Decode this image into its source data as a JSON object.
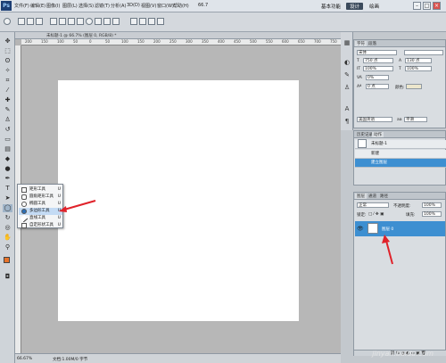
{
  "menubar": {
    "logo": "Ps",
    "items": [
      "文件(F)",
      "编辑(E)",
      "图像(I)",
      "图层(L)",
      "选择(S)",
      "滤镜(T)",
      "分析(A)",
      "3D(D)",
      "视图(V)",
      "窗口(W)",
      "帮助(H)"
    ],
    "zoom": "66.7",
    "workspaces": [
      "基本功能",
      "设计",
      "绘画"
    ],
    "win_min": "–",
    "win_max": "□",
    "win_close": "×"
  },
  "document": {
    "tab_title": "未标题-1 @ 66.7% (图层 0, RGB/8) *",
    "ruler_ticks": [
      "200",
      "150",
      "100",
      "50",
      "0",
      "50",
      "100",
      "150",
      "200",
      "250",
      "300",
      "350",
      "400",
      "450",
      "500",
      "550",
      "600",
      "650",
      "700",
      "750"
    ]
  },
  "status": {
    "zoom": "66.67%",
    "doc_info": "文档:1.00M/0 字节"
  },
  "flyout": {
    "items": [
      {
        "label": "矩形工具",
        "key": "U"
      },
      {
        "label": "圆角矩形工具",
        "key": "U"
      },
      {
        "label": "椭圆工具",
        "key": "U"
      },
      {
        "label": "多边形工具",
        "key": "U"
      },
      {
        "label": "直线工具",
        "key": "U"
      },
      {
        "label": "自定形状工具",
        "key": "U"
      }
    ]
  },
  "char_panel": {
    "tabs": [
      "字符",
      "段落"
    ],
    "font": "宋体",
    "size": "750 点",
    "leading": "130 点",
    "tracking": "100%",
    "scale": "100%",
    "kerning": "0%",
    "baseline": "0 点",
    "color_label": "颜色:",
    "language": "美国英语",
    "aa_symbol": "aa",
    "aa": "平滑"
  },
  "history_panel": {
    "tabs": [
      "历史记录",
      "动作"
    ],
    "snapshot": "未标题-1",
    "items": [
      "新建",
      "建立图层"
    ]
  },
  "layers_panel": {
    "tabs": [
      "图层",
      "通道",
      "路径"
    ],
    "blend_mode": "正常",
    "opacity_label": "不透明度:",
    "opacity": "100%",
    "lock_label": "锁定:",
    "fill_label": "填充:",
    "fill": "100%",
    "layer_name": "图层 0"
  },
  "watermark": "jinyan.baidu.com",
  "colors": {
    "accent": "#3d8fd1",
    "annotation": "#e0222a"
  }
}
